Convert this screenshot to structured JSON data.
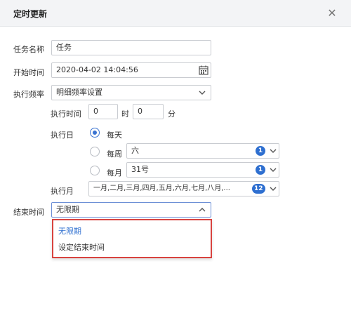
{
  "dialog": {
    "title": "定时更新",
    "close_icon": "close-icon"
  },
  "form": {
    "task_name_label": "任务名称",
    "task_name_value": "任务",
    "start_time_label": "开始时间",
    "start_time_value": "2020-04-02 14:04:56",
    "frequency_label": "执行频率",
    "frequency_value": "明细频率设置",
    "exec_time_label": "执行时间",
    "hour_value": "0",
    "hour_unit": "时",
    "minute_value": "0",
    "minute_unit": "分",
    "exec_day_label": "执行日",
    "daily_label": "每天",
    "weekly_label": "每周",
    "weekly_value": "六",
    "weekly_count": "1",
    "monthly_label": "每月",
    "monthly_value": "31号",
    "monthly_count": "1",
    "exec_month_label": "执行月",
    "months_value": "一月,二月,三月,四月,五月,六月,七月,八月,...",
    "months_count": "12",
    "end_time_label": "结束时间",
    "end_time_value": "无限期"
  },
  "end_dropdown": {
    "options": [
      "无限期",
      "设定结束时间"
    ]
  },
  "colors": {
    "accent": "#2e6fd0",
    "highlight": "#d8433f",
    "selected_option": "#2e6fd0"
  }
}
